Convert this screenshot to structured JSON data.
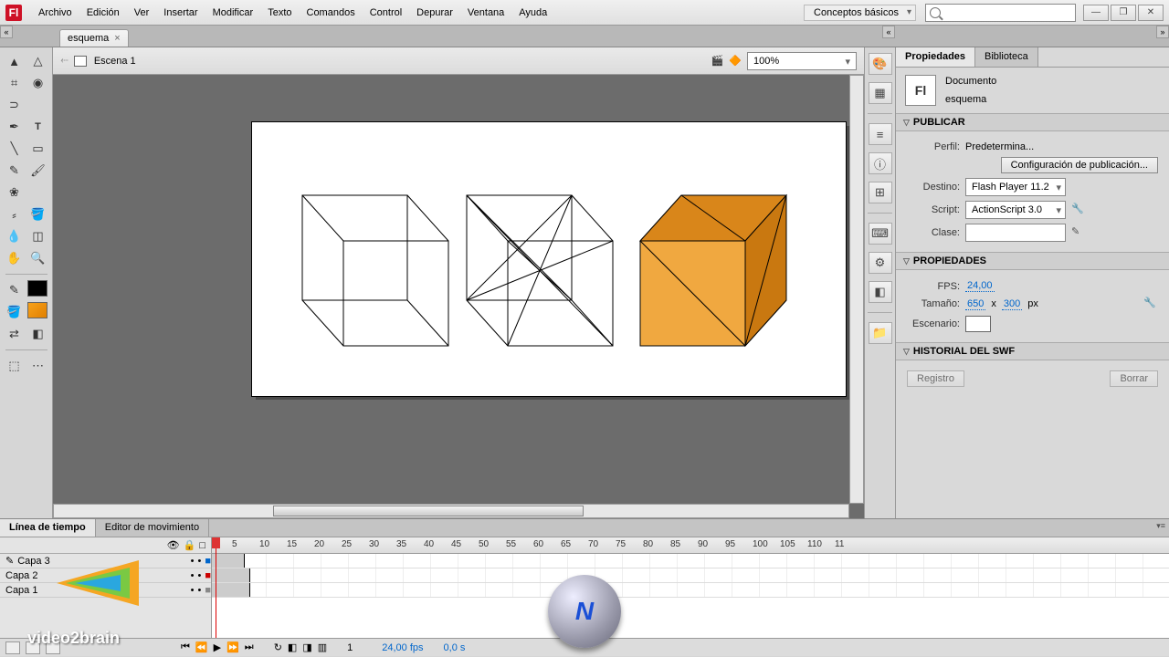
{
  "menu": {
    "items": [
      "Archivo",
      "Edición",
      "Ver",
      "Insertar",
      "Modificar",
      "Texto",
      "Comandos",
      "Control",
      "Depurar",
      "Ventana",
      "Ayuda"
    ]
  },
  "workspace": "Conceptos básicos",
  "doc_tab": "esquema",
  "scene": "Escena 1",
  "zoom": "100%",
  "panel": {
    "tabs": {
      "properties": "Propiedades",
      "library": "Biblioteca"
    },
    "doc_label": "Documento",
    "doc_name": "esquema",
    "publish": {
      "title": "PUBLICAR",
      "profile_label": "Perfil:",
      "profile_value": "Predetermina...",
      "config_btn": "Configuración de publicación...",
      "target_label": "Destino:",
      "target_value": "Flash Player 11.2",
      "script_label": "Script:",
      "script_value": "ActionScript 3.0",
      "class_label": "Clase:"
    },
    "props": {
      "title": "PROPIEDADES",
      "fps_label": "FPS:",
      "fps_value": "24,00",
      "size_label": "Tamaño:",
      "size_w": "650",
      "size_x": "x",
      "size_h": "300",
      "size_unit": "px",
      "stage_label": "Escenario:"
    },
    "swf": {
      "title": "HISTORIAL DEL SWF",
      "log_btn": "Registro",
      "clear_btn": "Borrar"
    }
  },
  "timeline": {
    "tab_timeline": "Línea de tiempo",
    "tab_motion": "Editor de movimiento",
    "ruler": [
      "5",
      "10",
      "15",
      "20",
      "25",
      "30",
      "35",
      "40",
      "45",
      "50",
      "55",
      "60",
      "65",
      "70",
      "75",
      "80",
      "85",
      "90",
      "95",
      "100",
      "105",
      "110",
      "11"
    ],
    "layers": [
      "Capa 3",
      "Capa 2",
      "Capa 1"
    ],
    "frame": "1",
    "fps": "24,00 fps",
    "time": "0,0 s"
  },
  "watermark": "video2brain",
  "wm_center": "N"
}
